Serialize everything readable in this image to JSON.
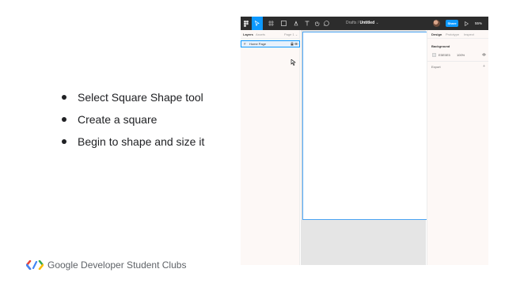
{
  "bullets": [
    "Select Square Shape tool",
    "Create a square",
    "Begin to shape and size it"
  ],
  "footer": {
    "logo_text": "Google Developer Student Clubs",
    "logo_colors": [
      "#4285f4",
      "#ea4335",
      "#34a853",
      "#fbbc04"
    ]
  },
  "figma": {
    "toolbar": {
      "menu_icon": "figma-logo-icon",
      "tools": [
        "move-tool-icon",
        "frame-tool-icon",
        "shape-tool-icon",
        "pen-tool-icon",
        "text-tool-icon",
        "hand-tool-icon",
        "comment-icon"
      ],
      "drafts_label": "Drafts",
      "separator": "/",
      "file_name": "Untitled",
      "share_label": "Share",
      "zoom": "55%"
    },
    "left_panel": {
      "tabs": [
        "Layers",
        "Assets"
      ],
      "page_label": "Page 1",
      "layers": [
        {
          "name": "Home Page"
        }
      ]
    },
    "right_panel": {
      "tabs": [
        "Design",
        "Prototype",
        "Inspect"
      ],
      "background_label": "Background",
      "bg_color": "E5E5E5",
      "bg_opacity": "100%",
      "export_label": "Export"
    }
  },
  "colors": {
    "accent": "#0d99ff",
    "toolbar": "#2c2c2c",
    "panel": "#fdf8f6",
    "canvas": "#e5e5e5"
  }
}
